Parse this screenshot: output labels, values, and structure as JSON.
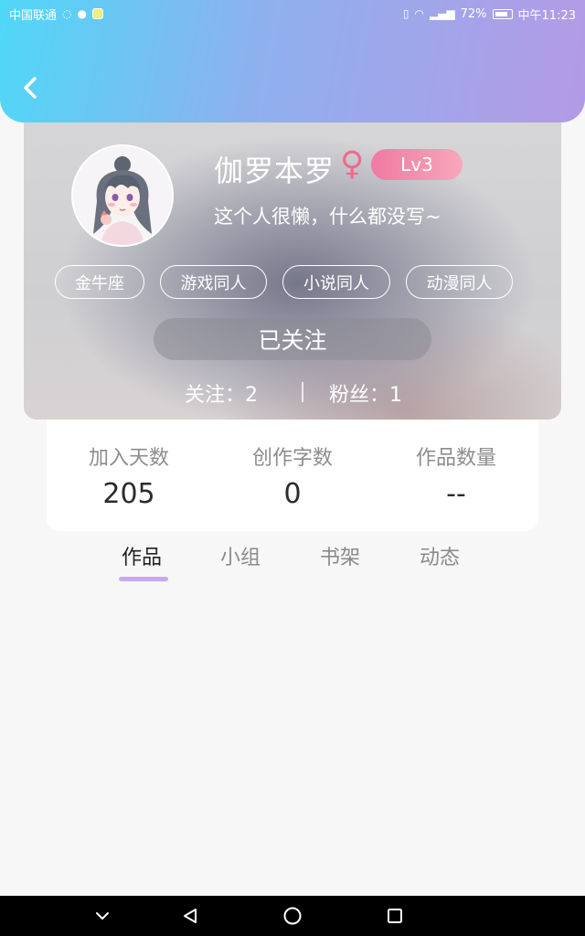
{
  "status_bar": {
    "carrier": "中国联通",
    "battery": "72%",
    "time": "中午11:23"
  },
  "header": {
    "back_icon": "chevron-left-icon"
  },
  "profile": {
    "username": "伽罗本罗",
    "gender_symbol": "♀",
    "level": "Lv3",
    "bio": "这个人很懒，什么都没写~",
    "tags": [
      "金牛座",
      "游戏同人",
      "小说同人",
      "动漫同人"
    ],
    "follow_label": "已关注",
    "following_label": "关注：2",
    "fans_label": "粉丝：1"
  },
  "stats": [
    {
      "label": "加入天数",
      "value": "205"
    },
    {
      "label": "创作字数",
      "value": "0"
    },
    {
      "label": "作品数量",
      "value": "--"
    }
  ],
  "tabs": [
    {
      "label": "作品",
      "active": true
    },
    {
      "label": "小组",
      "active": false
    },
    {
      "label": "书架",
      "active": false
    },
    {
      "label": "动态",
      "active": false
    }
  ],
  "colors": {
    "accent": "#c6a9ee",
    "gender": "#f06a8e",
    "level_badge": "#f07aa2"
  }
}
